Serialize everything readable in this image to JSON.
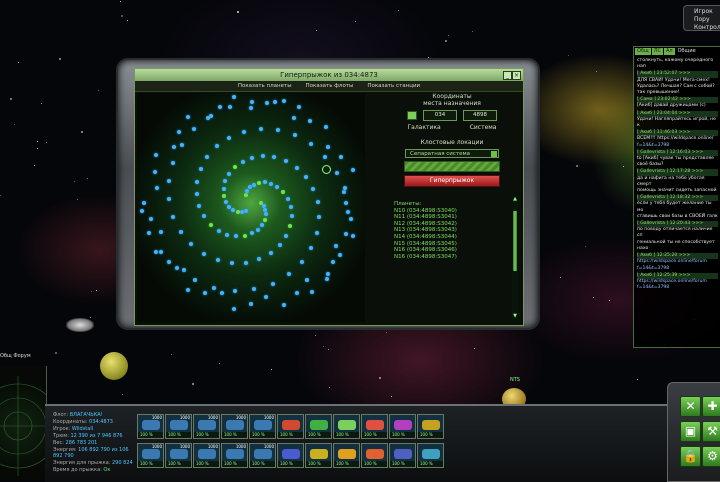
{
  "top_right": {
    "line1": "Игрок",
    "line2": "Пору",
    "line3": "Контроль"
  },
  "hyperjump": {
    "title": "Гиперпрыжок из 034:4873",
    "menu": [
      "Показать планеты",
      "Показать флоты",
      "Показать станции"
    ],
    "coords_title_1": "Координаты",
    "coords_title_2": "места назначения",
    "galaxy_value": "034",
    "system_value": "4898",
    "galaxy_label": "Галактика",
    "system_label": "Система",
    "shortcuts_title": "Клостовые локации",
    "shortcut_selected": "Сепаратная система",
    "jump_button": "Гиперпрыжок",
    "planets_header": "Планеты:",
    "planets": [
      "N10 (034:4898:S3040)",
      "N11 (034:4898:S3041)",
      "N12 (034:4898:S3042)",
      "N13 (034:4898:S3043)",
      "N14 (034:4898:S3044)",
      "N15 (034:4898:S3045)",
      "N16 (034:4898:S3046)",
      "N16 (034:4898:S3047)"
    ]
  },
  "chat": {
    "tabs": [
      "Общ",
      "ЛС",
      "Ал",
      "Общие"
    ],
    "lines": [
      {
        "type": "t",
        "text": "столкнуть, кажому очередного нап"
      },
      {
        "type": "h",
        "text": "[ Акиб ] 23:52:07 >>>"
      },
      {
        "type": "t",
        "text": "ДЛЯ СВАИ! Удачи! Мега-смех!"
      },
      {
        "type": "t",
        "text": "Удалась? Лечшая? Сам с собой?"
      },
      {
        "type": "t",
        "text": "так превышение!"
      },
      {
        "type": "h",
        "text": "[ Сама ] 23:02:42 >>>"
      },
      {
        "type": "t",
        "text": "[Акиб] давай дружицами (с)"
      },
      {
        "type": "h",
        "text": "[ Акиб ] 23:04:04 >>>"
      },
      {
        "type": "t",
        "text": "Удачи! Нагляпрайтесь игрой, не к"
      },
      {
        "type": "h",
        "text": "[ Акиб ] 11:46:03 >>>"
      },
      {
        "type": "t",
        "text": "ВСЕМ!!! https://wildspace.online/"
      },
      {
        "type": "l",
        "text": "f=14&t=3798"
      },
      {
        "type": "h",
        "text": "[ Gallevrista ] 12:16:03 >>>"
      },
      {
        "type": "t",
        "text": "to [Акиб] чувак ты представляе"
      },
      {
        "type": "t",
        "text": "своё базы?"
      },
      {
        "type": "h",
        "text": "[ Gallevrista ] 12:17:28 >>>"
      },
      {
        "type": "t",
        "text": "да и нафига на тебе убогая смерт"
      },
      {
        "type": "t",
        "text": "помощь значит сидеть запасной"
      },
      {
        "type": "h",
        "text": "[ Gallevrista ] 12:18:32 >>>"
      },
      {
        "type": "t",
        "text": "если у тебя будет желание ты мо"
      },
      {
        "type": "t",
        "text": "ставишь свои базы в СВОЕЙ галк"
      },
      {
        "type": "h",
        "text": "[ Gallevrista ] 12:20:43 >>>"
      },
      {
        "type": "t",
        "text": "по поводу отличается наличие сп"
      },
      {
        "type": "t",
        "text": "гениальной ты не способствует нахо"
      },
      {
        "type": "h",
        "text": "[ Акиб ] 12:25:20 >>>"
      },
      {
        "type": "l",
        "text": "https://wildspace.online/forum"
      },
      {
        "type": "l",
        "text": "f=14&t=3798"
      },
      {
        "type": "h",
        "text": "[ Акиб ] 12:25:39 >>>"
      },
      {
        "type": "l",
        "text": "https://wildspace.online/forum"
      },
      {
        "type": "l",
        "text": "f=14&t=3798"
      }
    ]
  },
  "radar": {
    "tabs": "Общ Форум"
  },
  "ship": {
    "rows": [
      {
        "k": "Флот: ",
        "v": "ВЛАГАЧЬКА!",
        "c": "v"
      },
      {
        "k": "Координаты: ",
        "v": "034:4873",
        "c": "v"
      },
      {
        "k": "Игрок: ",
        "v": "Wildstall",
        "c": "v"
      },
      {
        "k": "Трюм: ",
        "v": "12 390 из 7 946 876",
        "c": "v"
      },
      {
        "k": "Вес: ",
        "v": "286 783 201",
        "c": "v"
      },
      {
        "k": "Энергия: ",
        "v": "106 892 790 из 106 892 790",
        "c": "v"
      },
      {
        "k": "Энергия для прыжка: ",
        "v": "290 824",
        "c": "v"
      },
      {
        "k": "Время до прыжка: ",
        "v": "Ок",
        "c": "vr"
      }
    ]
  },
  "slots": [
    {
      "lv": "1000",
      "pc": "100 %"
    },
    {
      "lv": "1000",
      "pc": "100 %"
    },
    {
      "lv": "1000",
      "pc": "100 %"
    },
    {
      "lv": "1000",
      "pc": "100 %"
    },
    {
      "lv": "1000",
      "pc": "100 %"
    },
    {
      "lv": "",
      "pc": "100 %"
    },
    {
      "lv": "",
      "pc": "100 %"
    },
    {
      "lv": "",
      "pc": "100 %"
    },
    {
      "lv": "",
      "pc": "100 %"
    },
    {
      "lv": "",
      "pc": "100 %"
    },
    {
      "lv": "",
      "pc": "100 %"
    },
    {
      "lv": "1000",
      "pc": "100 %"
    },
    {
      "lv": "1000",
      "pc": "100 %"
    },
    {
      "lv": "1000",
      "pc": "100 %"
    },
    {
      "lv": "1000",
      "pc": "100 %"
    },
    {
      "lv": "1000",
      "pc": "100 %"
    },
    {
      "lv": "",
      "pc": "100 %"
    },
    {
      "lv": "",
      "pc": "100 %"
    },
    {
      "lv": "",
      "pc": "100 %"
    },
    {
      "lv": "",
      "pc": "100 %"
    },
    {
      "lv": "",
      "pc": "100 %"
    },
    {
      "lv": "",
      "pc": "100 %"
    }
  ],
  "planet_label": "NTS",
  "colors": {
    "accent": "#7ad05a",
    "blue_star": "#44b4ff",
    "jump_red": "#c03030"
  }
}
